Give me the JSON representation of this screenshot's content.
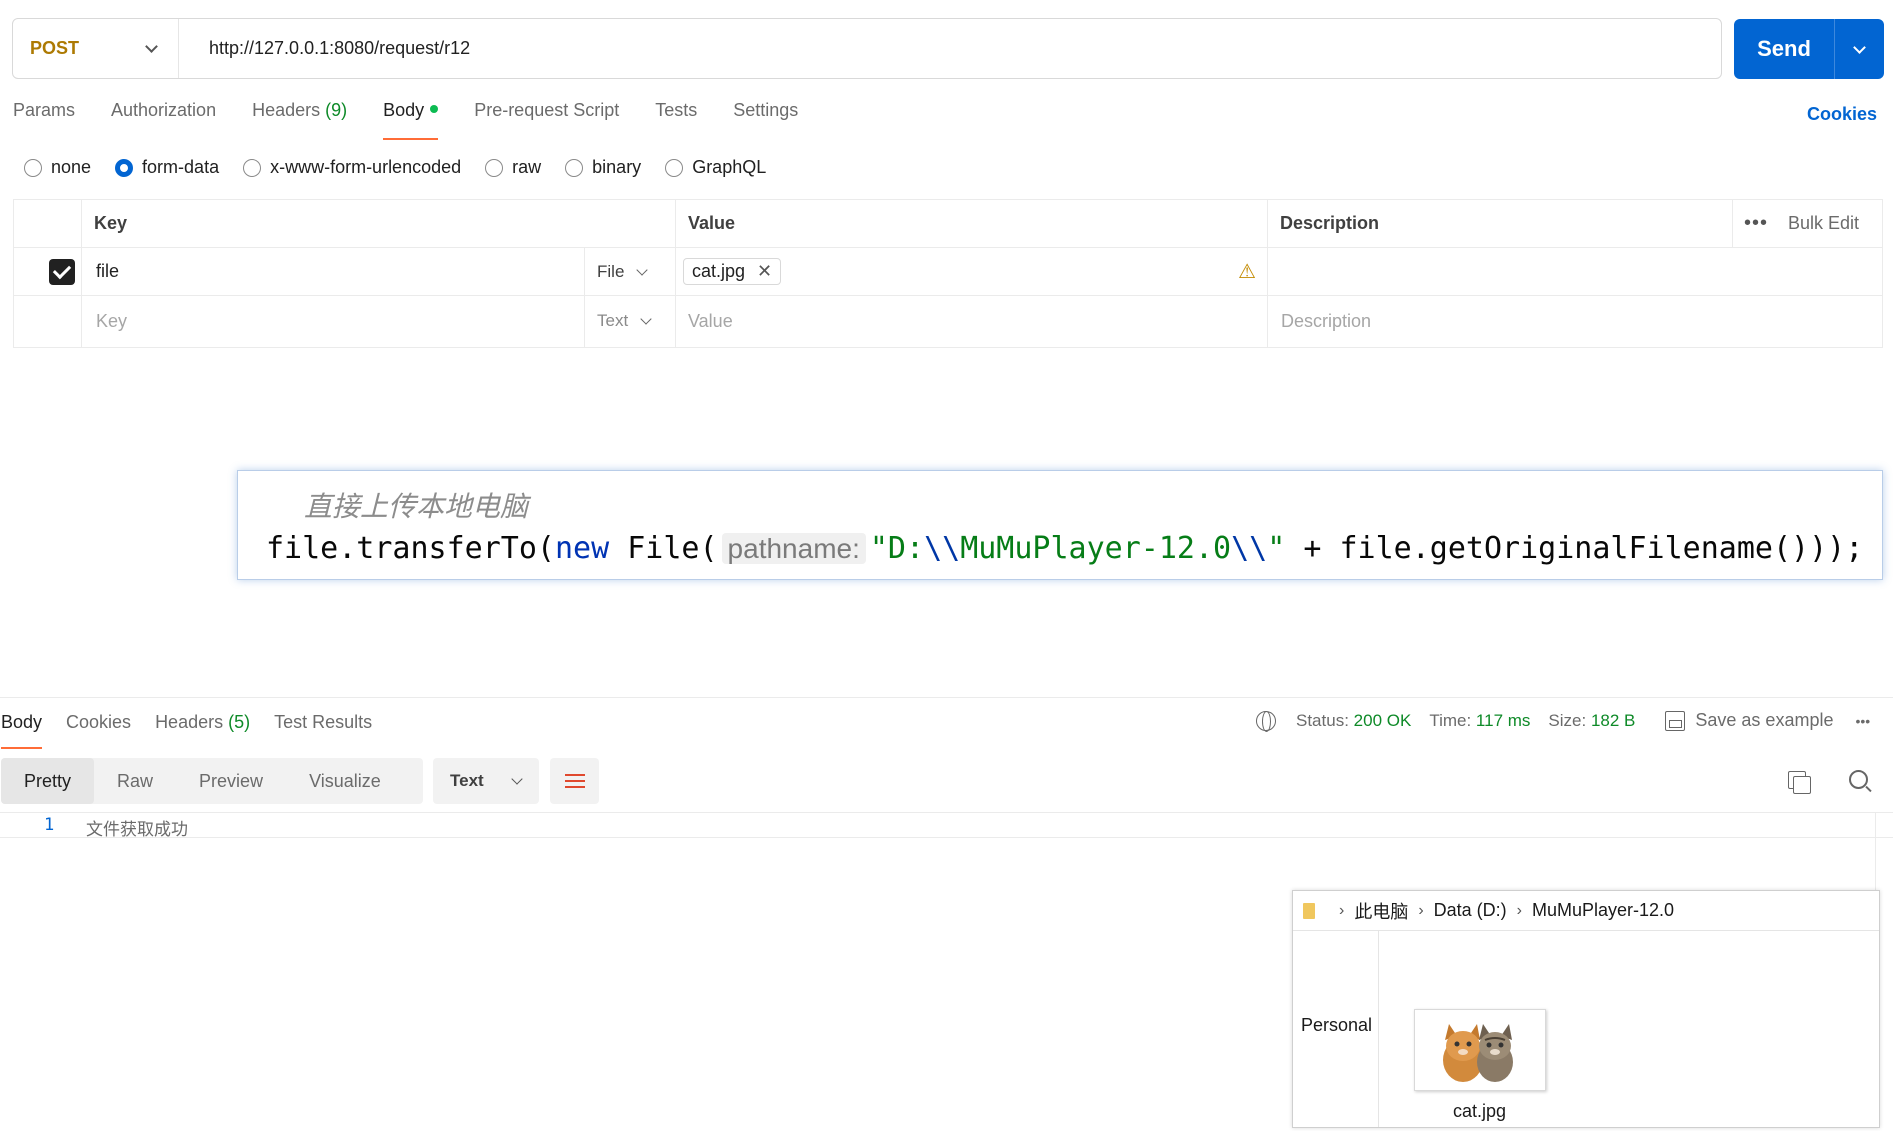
{
  "request": {
    "method": "POST",
    "url": "http://127.0.0.1:8080/request/r12",
    "send_label": "Send"
  },
  "tabs": {
    "params": "Params",
    "authorization": "Authorization",
    "headers": "Headers",
    "headers_count": "(9)",
    "body": "Body",
    "pre_request": "Pre-request Script",
    "tests": "Tests",
    "settings": "Settings",
    "cookies": "Cookies"
  },
  "body_types": {
    "none": "none",
    "form_data": "form-data",
    "urlencoded": "x-www-form-urlencoded",
    "raw": "raw",
    "binary": "binary",
    "graphql": "GraphQL",
    "selected": "form-data"
  },
  "form_table": {
    "headers": {
      "key": "Key",
      "value": "Value",
      "description": "Description",
      "bulk_edit": "Bulk Edit"
    },
    "rows": [
      {
        "key": "file",
        "type": "File",
        "value": "cat.jpg",
        "checked": true
      }
    ],
    "new_row": {
      "key_placeholder": "Key",
      "type": "Text",
      "value_placeholder": "Value",
      "description_placeholder": "Description"
    }
  },
  "code_overlay": {
    "comment": "直接上传本地电脑",
    "code_part1": "file.transferTo(",
    "keyword_new": "new",
    "code_part2": " File(",
    "param_hint": "pathname:",
    "string_part1": "\"D:",
    "escape1": "\\\\",
    "string_part2": "MuMuPlayer-12.0",
    "escape2": "\\\\",
    "string_part3": "\"",
    "code_part3": " + file.getOriginalFilename()));"
  },
  "response": {
    "tabs": {
      "body": "Body",
      "cookies": "Cookies",
      "headers": "Headers",
      "headers_count": "(5)",
      "test_results": "Test Results"
    },
    "status_label": "Status:",
    "status_value": "200 OK",
    "time_label": "Time:",
    "time_value": "117 ms",
    "size_label": "Size:",
    "size_value": "182 B",
    "save_example": "Save as example",
    "more": "•••",
    "views": {
      "pretty": "Pretty",
      "raw": "Raw",
      "preview": "Preview",
      "visualize": "Visualize"
    },
    "format": "Text",
    "line_number": "1",
    "line_text": "文件获取成功"
  },
  "explorer": {
    "crumbs": [
      "此电脑",
      "Data (D:)",
      "MuMuPlayer-12.0"
    ],
    "nav_item": "Personal",
    "file_name": "cat.jpg"
  },
  "colors": {
    "accent": "#0265d2",
    "tab_underline": "#ff6c37",
    "success": "#0e8a28",
    "method": "#ad7a03"
  }
}
